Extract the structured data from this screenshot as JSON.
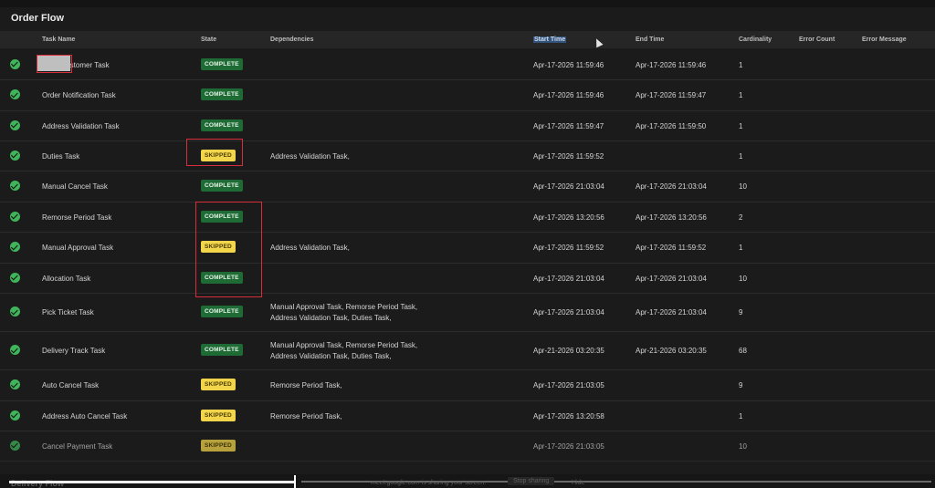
{
  "page": {
    "title": "Order Flow"
  },
  "columns": {
    "task_name": "Task Name",
    "state": "State",
    "dependencies": "Dependencies",
    "start_time": "Start Time",
    "end_time": "End Time",
    "cardinality": "Cardinality",
    "error_count": "Error Count",
    "error_message": "Error Message"
  },
  "rows": [
    {
      "task": "OMS Customer Task",
      "state": "COMPLETE",
      "deps1": "",
      "deps2": "",
      "start": "Apr-17-2026 11:59:46",
      "end": "Apr-17-2026 11:59:46",
      "card": "1"
    },
    {
      "task": "Order Notification Task",
      "state": "COMPLETE",
      "deps1": "",
      "deps2": "",
      "start": "Apr-17-2026 11:59:46",
      "end": "Apr-17-2026 11:59:47",
      "card": "1"
    },
    {
      "task": "Address Validation Task",
      "state": "COMPLETE",
      "deps1": "",
      "deps2": "",
      "start": "Apr-17-2026 11:59:47",
      "end": "Apr-17-2026 11:59:50",
      "card": "1"
    },
    {
      "task": "Duties Task",
      "state": "SKIPPED",
      "deps1": "Address Validation Task,",
      "deps2": "",
      "start": "Apr-17-2026 11:59:52",
      "end": "",
      "card": "1"
    },
    {
      "task": "Manual Cancel Task",
      "state": "COMPLETE",
      "deps1": "",
      "deps2": "",
      "start": "Apr-17-2026 21:03:04",
      "end": "Apr-17-2026 21:03:04",
      "card": "10"
    },
    {
      "task": "Remorse Period Task",
      "state": "COMPLETE",
      "deps1": "",
      "deps2": "",
      "start": "Apr-17-2026 13:20:56",
      "end": "Apr-17-2026 13:20:56",
      "card": "2"
    },
    {
      "task": "Manual Approval Task",
      "state": "SKIPPED",
      "deps1": "Address Validation Task,",
      "deps2": "",
      "start": "Apr-17-2026 11:59:52",
      "end": "Apr-17-2026 11:59:52",
      "card": "1"
    },
    {
      "task": "Allocation Task",
      "state": "COMPLETE",
      "deps1": "",
      "deps2": "",
      "start": "Apr-17-2026 21:03:04",
      "end": "Apr-17-2026 21:03:04",
      "card": "10"
    },
    {
      "task": "Pick Ticket Task",
      "state": "COMPLETE",
      "deps1": "Manual Approval Task, Remorse Period Task,",
      "deps2": "Address Validation Task, Duties Task,",
      "start": "Apr-17-2026 21:03:04",
      "end": "Apr-17-2026 21:03:04",
      "card": "9"
    },
    {
      "task": "Delivery Track Task",
      "state": "COMPLETE",
      "deps1": "Manual Approval Task, Remorse Period Task,",
      "deps2": "Address Validation Task, Duties Task,",
      "start": "Apr-21-2026 03:20:35",
      "end": "Apr-21-2026 03:20:35",
      "card": "68"
    },
    {
      "task": "Auto Cancel Task",
      "state": "SKIPPED",
      "deps1": "Remorse Period Task,",
      "deps2": "",
      "start": "Apr-17-2026 21:03:05",
      "end": "",
      "card": "9"
    },
    {
      "task": "Address Auto Cancel Task",
      "state": "SKIPPED",
      "deps1": "Remorse Period Task,",
      "deps2": "",
      "start": "Apr-17-2026 13:20:58",
      "end": "",
      "card": "1"
    },
    {
      "task": "Cancel Payment Task",
      "state": "SKIPPED",
      "deps1": "",
      "deps2": "",
      "start": "Apr-17-2026 21:03:05",
      "end": "",
      "card": "10"
    }
  ],
  "footer": {
    "next_section": "Delivery Flow",
    "share_notice": "meet.google.com is sharing your screen.",
    "stop_sharing": "Stop sharing",
    "hide": "Hide"
  }
}
